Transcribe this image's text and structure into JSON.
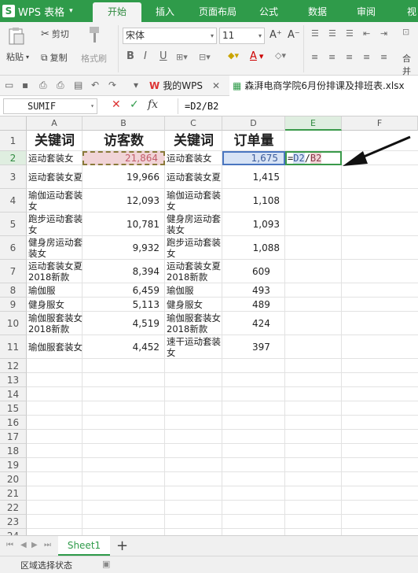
{
  "app": {
    "logo": "WPS 表格",
    "logo_letter": "S"
  },
  "tabs": [
    "开始",
    "插入",
    "页面布局",
    "公式",
    "数据",
    "审阅",
    "视"
  ],
  "ribbon": {
    "paste": "粘贴",
    "cut": "剪切",
    "copy": "复制",
    "format_painter": "格式刷",
    "font_name": "宋体",
    "font_size": "11",
    "bold": "B",
    "italic": "I",
    "underline": "U",
    "grow_font": "A⁺",
    "shrink_font": "A⁻",
    "merge": "合并"
  },
  "quickbar": {
    "tab_home": "我的WPS",
    "tab_file": "森湃电商学院6月份排课及排班表.xlsx"
  },
  "formula_bar": {
    "name_box": "SUMIF",
    "fx": "fx",
    "formula": "=D2/B2",
    "cancel": "✕",
    "confirm": "✓"
  },
  "columns": [
    "A",
    "B",
    "C",
    "D",
    "E",
    "F"
  ],
  "rows": [
    "1",
    "2",
    "3",
    "4",
    "5",
    "6",
    "7",
    "8",
    "9",
    "10",
    "11",
    "12",
    "13",
    "14",
    "15",
    "16",
    "17",
    "18",
    "19",
    "20",
    "21",
    "22",
    "23",
    "24"
  ],
  "table": {
    "headers": [
      "关键词",
      "访客数",
      "关键词",
      "订单量"
    ],
    "data": [
      [
        "运动套装女",
        "21,864",
        "运动套装女",
        "1,675"
      ],
      [
        "运动套装女夏",
        "19,966",
        "运动套装女夏",
        "1,415"
      ],
      [
        "瑜伽运动套装女",
        "12,093",
        "瑜伽运动套装女",
        "1,108"
      ],
      [
        "跑步运动套装女",
        "10,781",
        "健身房运动套装女",
        "1,093"
      ],
      [
        "健身房运动套装女",
        "9,932",
        "跑步运动套装女",
        "1,088"
      ],
      [
        "运动套装女夏2018新款",
        "8,394",
        "运动套装女夏2018新款",
        "609"
      ],
      [
        "瑜伽服",
        "6,459",
        "瑜伽服",
        "493"
      ],
      [
        "健身服女",
        "5,113",
        "健身服女",
        "489"
      ],
      [
        "瑜伽服套装女2018新款",
        "4,519",
        "瑜伽服套装女2018新款",
        "424"
      ],
      [
        "瑜伽服套装女",
        "4,452",
        "速干运动套装女",
        "397"
      ]
    ],
    "edit_cell": {
      "eq": "=",
      "ref1": "D2",
      "op": " / ",
      "ref2": "B2"
    }
  },
  "sheet_tabs": [
    "Sheet1"
  ],
  "status": {
    "text": "区域选择状态"
  },
  "colors": {
    "brand": "#2f9b4a",
    "ref_d2": "#d7e3f5",
    "ref_b2": "#f1d4d7"
  }
}
